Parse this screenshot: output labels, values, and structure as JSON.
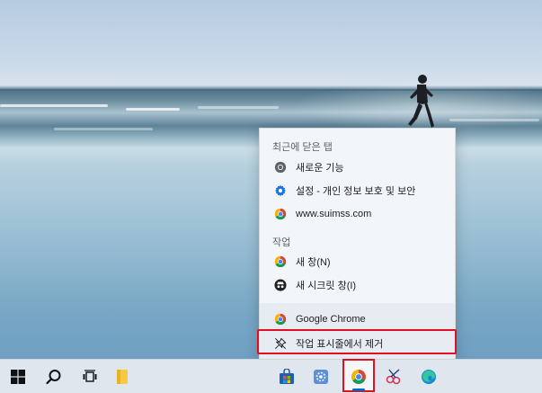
{
  "menu": {
    "recent_header": "최근에 닫은 탭",
    "recent_items": [
      {
        "label": "새로운 기능",
        "icon": "chrome-gray-icon"
      },
      {
        "label": "설정 - 개인 정보 보호 및 보안",
        "icon": "settings-gear-icon"
      },
      {
        "label": "www.suimss.com",
        "icon": "chrome-icon"
      }
    ],
    "tasks_header": "작업",
    "task_items": [
      {
        "label": "새 창(N)",
        "icon": "chrome-icon"
      },
      {
        "label": "새 시크릿 창(I)",
        "icon": "incognito-icon"
      }
    ],
    "app_item": {
      "label": "Google Chrome",
      "icon": "chrome-icon"
    },
    "unpin_item": {
      "label": "작업 표시줄에서 제거",
      "icon": "unpin-icon"
    }
  },
  "taskbar": {
    "icons": [
      "windows-start-icon",
      "search-icon",
      "task-view-icon",
      "file-explorer-icon",
      "microsoft-store-icon",
      "settings-app-icon",
      "chrome-icon",
      "snipping-tool-icon",
      "edge-icon"
    ],
    "active_app": "chrome-icon"
  },
  "colors": {
    "highlight": "#e01020",
    "menu_bg": "#f3f6f9",
    "taskbar_bg": "#dfe6ee",
    "accent": "#0067c0"
  }
}
